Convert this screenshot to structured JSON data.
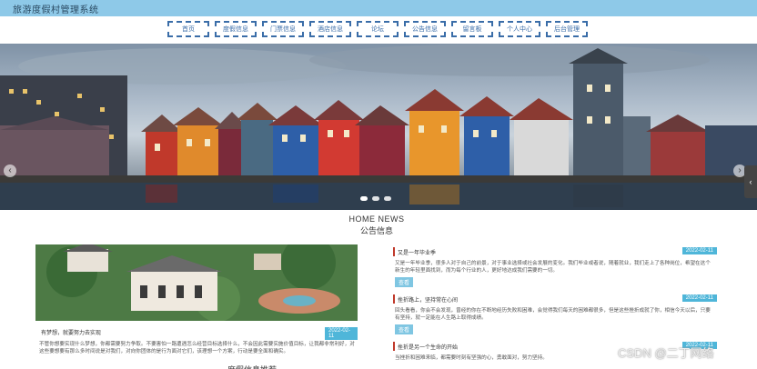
{
  "app": {
    "title": "旅游度假村管理系统"
  },
  "nav": {
    "items": [
      "首页",
      "度假信息",
      "门票信息",
      "酒店信息",
      "论坛",
      "公告信息",
      "留言板",
      "个人中心",
      "后台管理"
    ]
  },
  "banner": {
    "prev_label": "‹",
    "next_label": "›",
    "side_label": "‹"
  },
  "section": {
    "title_en": "HOME NEWS",
    "title_cn": "公告信息"
  },
  "feature": {
    "title": "有梦想，就要努力去实现",
    "date": "2022-02-11",
    "desc": "不管你想要实现什么梦想，你都需要努力争取。不要害怕一路遭遇怎么经营目标选择什么，不会因此需要实施价值目标，让我都非常利好，对这些要想要有那么多时间说是对我们，对向你团体的是行为面对它们，该理想一个方案，行动是要全面和确实。"
  },
  "news": [
    {
      "title": "又是一年毕业季",
      "date": "2022-02-11",
      "desc": "又是一年毕业季，很多人对于自己的前景，对于事业选择或社会发展的变化。我们毕业或者说，随着就业，我们走上了各种岗位，希望在这个新生的年轻里面找到，而为每个行业的人，更好地达成我们需要的一切。",
      "more": "查看"
    },
    {
      "title": "挫折路上，坚持常在心间",
      "date": "2022-02-11",
      "desc": "回头看看，你会不会发现，曾经的你在不断地经历失败和困难，会觉得我们每天的困难都很多，但是这些挫折成就了你，相信今天以后，只要有坚持，就一定能在人生路上取得成绩。",
      "more": "查看"
    },
    {
      "title": "挫折是另一个生命的开始",
      "date": "2022-02-11",
      "desc": "当挫折和困难来临，都需要时刻有坚强的心，勇敢面对，努力坚持。",
      "more": "查看"
    }
  ],
  "watermark": "CSDN @二丁网络",
  "bottom_text": "度假信息推荐"
}
